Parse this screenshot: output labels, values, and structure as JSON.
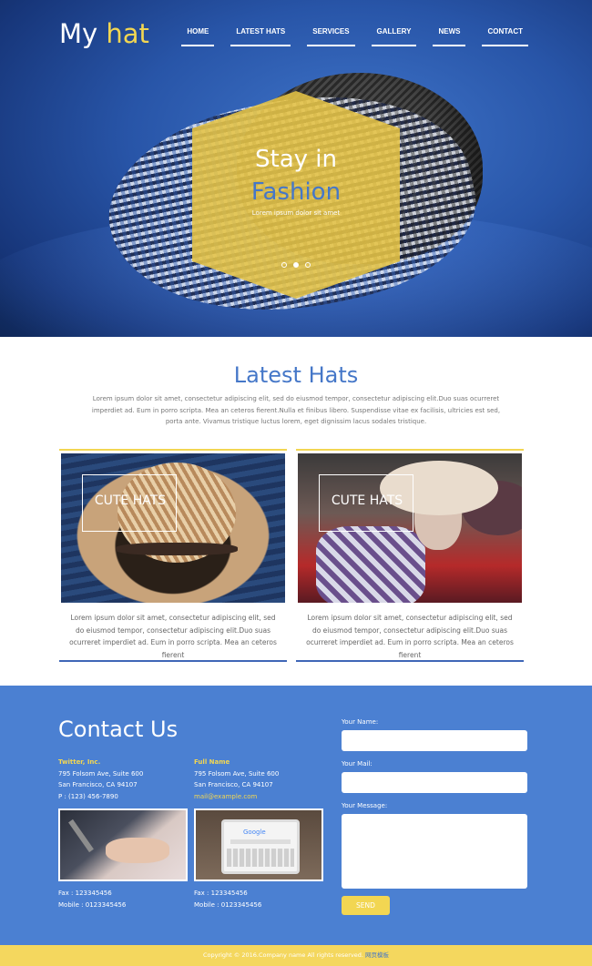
{
  "brand": {
    "logo_main": "My ",
    "logo_accent": "hat"
  },
  "nav": [
    "HOME",
    "LATEST HATS",
    "SERVICES",
    "GALLERY",
    "NEWS",
    "CONTACT"
  ],
  "hero": {
    "line1": "Stay in",
    "line2": "Fashion",
    "subtitle": "Lorem ipsum dolor sit amet",
    "slides": 3,
    "active_slide": 1
  },
  "latest": {
    "title": "Latest Hats",
    "intro": "Lorem ipsum dolor sit amet, consectetur adipiscing elit, sed do eiusmod tempor, consectetur adipiscing elit.Duo suas ocurreret imperdiet ad. Eum in porro scripta. Mea an ceteros fierent.Nulla et finibus libero. Suspendisse vitae ex facilisis, ultricies est sed, porta ante. Vivamus tristique luctus lorem, eget dignissim lacus sodales tristique.",
    "cards": [
      {
        "label": "CUTE HATS",
        "text": "Lorem ipsum dolor sit amet, consectetur adipiscing elit, sed do eiusmod tempor, consectetur adipiscing elit.Duo suas ocurreret imperdiet ad. Eum in porro scripta. Mea an ceteros fierent"
      },
      {
        "label": "CUTE HATS",
        "text": "Lorem ipsum dolor sit amet, consectetur adipiscing elit, sed do eiusmod tempor, consectetur adipiscing elit.Duo suas ocurreret imperdiet ad. Eum in porro scripta. Mea an ceteros fierent"
      }
    ]
  },
  "contact": {
    "title": "Contact Us",
    "addresses": [
      {
        "name": "Twitter, Inc.",
        "line1": "795 Folsom Ave, Suite 600",
        "line2": "San Francisco, CA 94107",
        "line3": "P : (123) 456-7890",
        "fax": "Fax : 123345456",
        "mobile": "Mobile : 0123345456"
      },
      {
        "name": "Full Name",
        "line1": "795 Folsom Ave, Suite 600",
        "line2": "San Francisco, CA 94107",
        "line3": "mail@example.com",
        "fax": "Fax : 123345456",
        "mobile": "Mobile : 0123345456"
      }
    ],
    "form": {
      "name_label": "Your Name:",
      "mail_label": "Your Mail:",
      "message_label": "Your Message:",
      "send": "SEND"
    },
    "image_text": "Google"
  },
  "footer": {
    "text": "Copyright © 2016.Company name All rights reserved.",
    "link": "网页模板"
  },
  "colors": {
    "accent_yellow": "#f2d652",
    "brand_blue": "#4577c8",
    "contact_bg": "#4b80d2"
  }
}
